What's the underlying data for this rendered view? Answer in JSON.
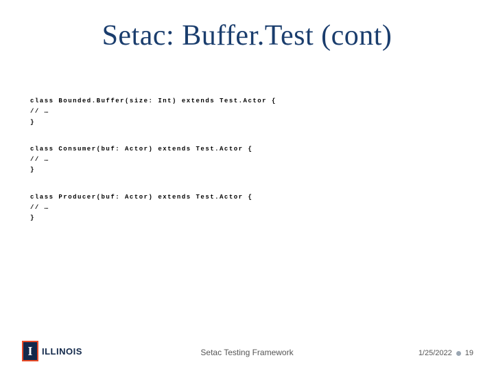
{
  "title": "Setac: Buffer.Test (cont)",
  "code": {
    "block1_l1": "class Bounded.Buffer(size: Int) extends Test.Actor {",
    "block1_l2": " // …",
    "block1_l3": "}",
    "block2_l1": "class Consumer(buf: Actor) extends Test.Actor {",
    "block2_l2": "// …",
    "block2_l3": " }",
    "block3_l1": "class Producer(buf: Actor) extends Test.Actor {",
    "block3_l2": "// …",
    "block3_l3": " }"
  },
  "footer": {
    "logo_text": "ILLINOIS",
    "center": "Setac Testing Framework",
    "date": "1/25/2022",
    "page": "19"
  }
}
